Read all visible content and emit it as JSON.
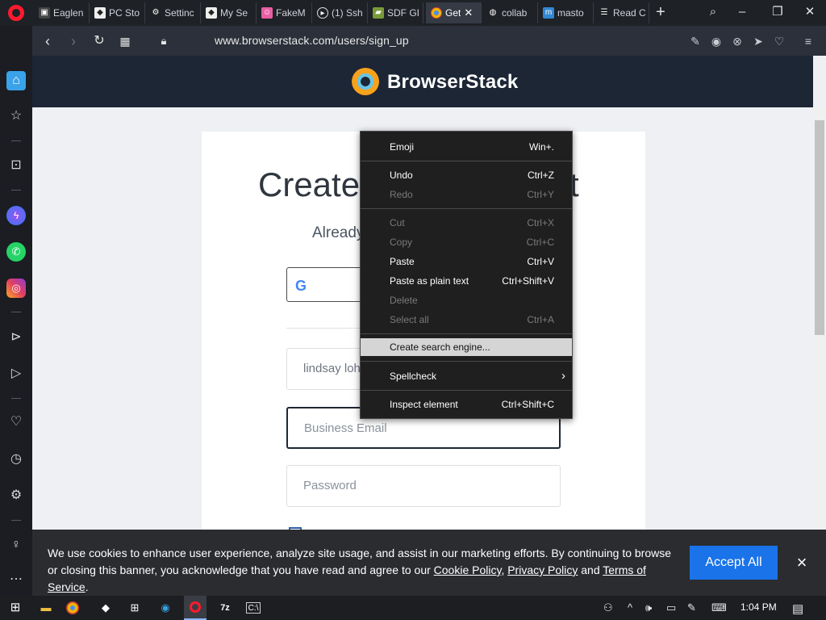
{
  "browser": {
    "tabs": [
      {
        "label": "Eaglen",
        "icon": "image-icon",
        "active": false
      },
      {
        "label": "PC Sto",
        "icon": "roblox-icon",
        "active": false
      },
      {
        "label": "Settinc",
        "icon": "gear-icon",
        "active": false
      },
      {
        "label": "My Se",
        "icon": "roblox-icon",
        "active": false
      },
      {
        "label": "FakeM",
        "icon": "face-icon",
        "active": false
      },
      {
        "label": "(1) Ssh",
        "icon": "play-icon",
        "active": false
      },
      {
        "label": "SDF GI",
        "icon": "folder-icon",
        "active": false
      },
      {
        "label": "Get",
        "icon": "chrome-icon",
        "active": true
      },
      {
        "label": "collab",
        "icon": "globe-icon",
        "active": false
      },
      {
        "label": "masto",
        "icon": "mastodon-icon",
        "active": false
      },
      {
        "label": "Read C",
        "icon": "reader-icon",
        "active": false
      }
    ],
    "new_tab": "+",
    "url": "www.browserstack.com/users/sign_up"
  },
  "page": {
    "brand": "BrowserStack",
    "heading_left": "Create",
    "heading_right": "t",
    "subheading": "Already",
    "name_value": "lindsay loha",
    "email_placeholder": "Business Email",
    "password_placeholder": "Password"
  },
  "context_menu": {
    "items": [
      {
        "label": "Emoji",
        "shortcut": "Win+.",
        "enabled": true
      },
      {
        "label": "Undo",
        "shortcut": "Ctrl+Z",
        "enabled": true
      },
      {
        "label": "Redo",
        "shortcut": "Ctrl+Y",
        "enabled": false
      },
      {
        "label": "Cut",
        "shortcut": "Ctrl+X",
        "enabled": false
      },
      {
        "label": "Copy",
        "shortcut": "Ctrl+C",
        "enabled": false
      },
      {
        "label": "Paste",
        "shortcut": "Ctrl+V",
        "enabled": true
      },
      {
        "label": "Paste as plain text",
        "shortcut": "Ctrl+Shift+V",
        "enabled": true
      },
      {
        "label": "Delete",
        "shortcut": "",
        "enabled": false
      },
      {
        "label": "Select all",
        "shortcut": "Ctrl+A",
        "enabled": false
      },
      {
        "label": "Create search engine...",
        "shortcut": "",
        "enabled": true,
        "highlighted": true
      },
      {
        "label": "Spellcheck",
        "shortcut": "›",
        "enabled": true
      },
      {
        "label": "Inspect element",
        "shortcut": "Ctrl+Shift+C",
        "enabled": true
      }
    ]
  },
  "cookie_banner": {
    "text_1": "We use cookies to enhance user experience, analyze site usage, and assist in our marketing efforts. By continuing to browse or closing this banner, you acknowledge that you have read and agree to our ",
    "cookie_policy": "Cookie Policy",
    "comma": ", ",
    "privacy_policy": "Privacy Policy",
    "and": " and ",
    "terms": "Terms of Service",
    "period": ".",
    "accept": "Accept All",
    "close": "×"
  },
  "taskbar": {
    "time": "1:04 PM"
  },
  "colors": {
    "accent": "#1a73e8",
    "opera_red": "#ff1b2d",
    "header_bg": "#1d2635"
  }
}
